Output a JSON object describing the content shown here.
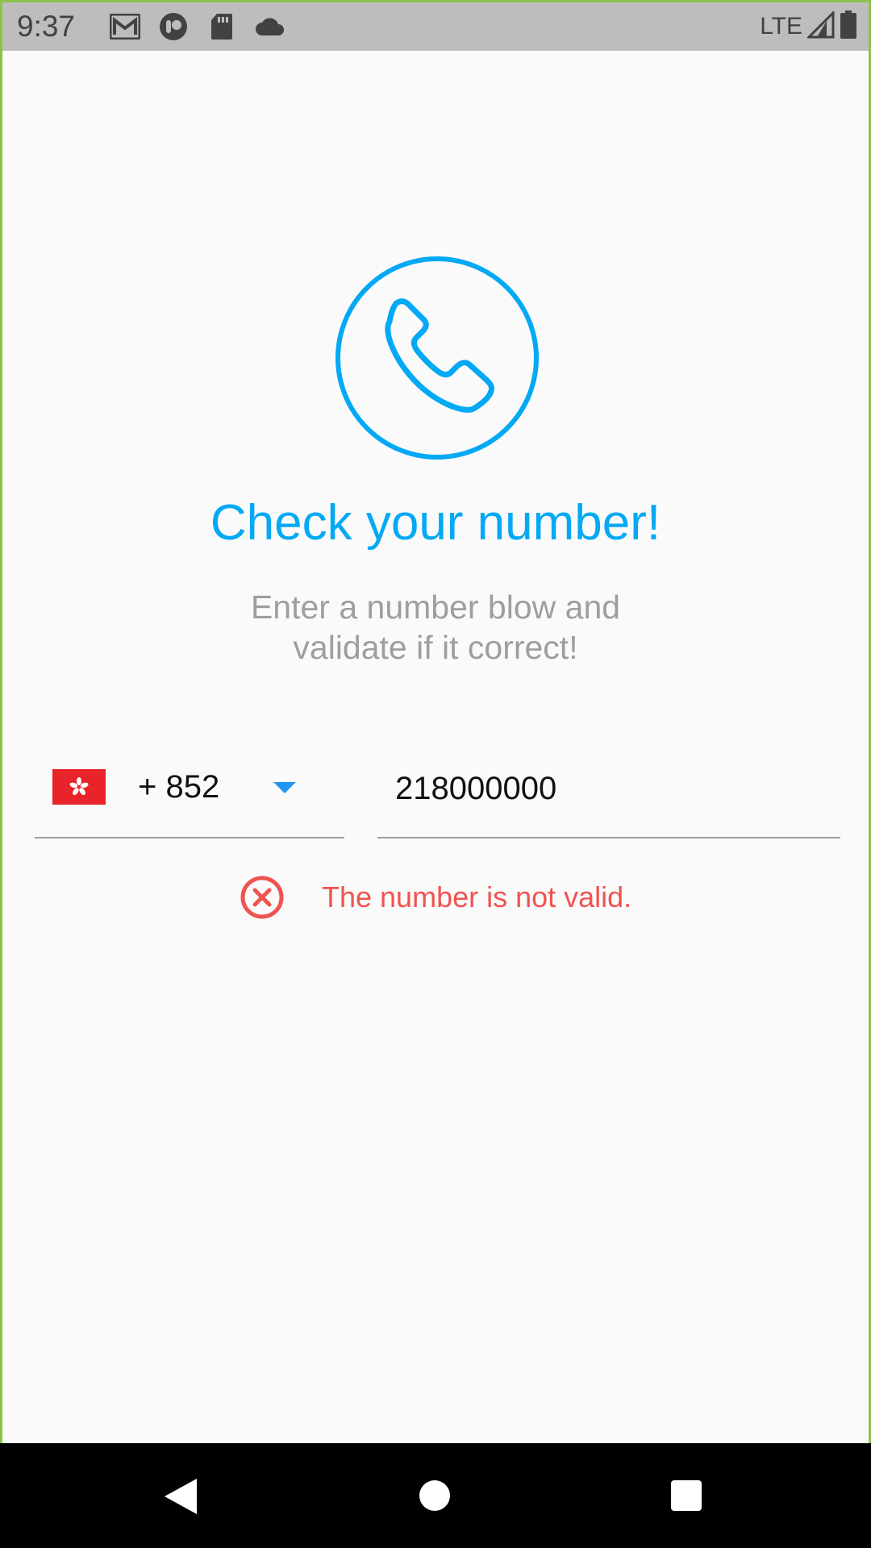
{
  "status_bar": {
    "time": "9:37",
    "network": "LTE",
    "icons": [
      "gmail-icon",
      "app-notification-icon",
      "sd-card-icon",
      "cloud-icon",
      "signal-icon",
      "battery-icon"
    ]
  },
  "main": {
    "hero_icon": "phone-icon",
    "title": "Check your number!",
    "subtitle_line1": "Enter a number blow and",
    "subtitle_line2": "validate if it correct!"
  },
  "phone_form": {
    "country_flag": "hong-kong-flag",
    "dial_code": "+ 852",
    "phone_value": "218000000"
  },
  "validation": {
    "icon": "error-circle-icon",
    "message": "The number is not valid."
  },
  "colors": {
    "accent": "#03a9f4",
    "error": "#ef5350",
    "dropdown": "#2196f3",
    "status_bar": "#bdbdbd"
  },
  "nav_bar": {
    "icons": [
      "back-icon",
      "home-icon",
      "recents-icon"
    ]
  }
}
